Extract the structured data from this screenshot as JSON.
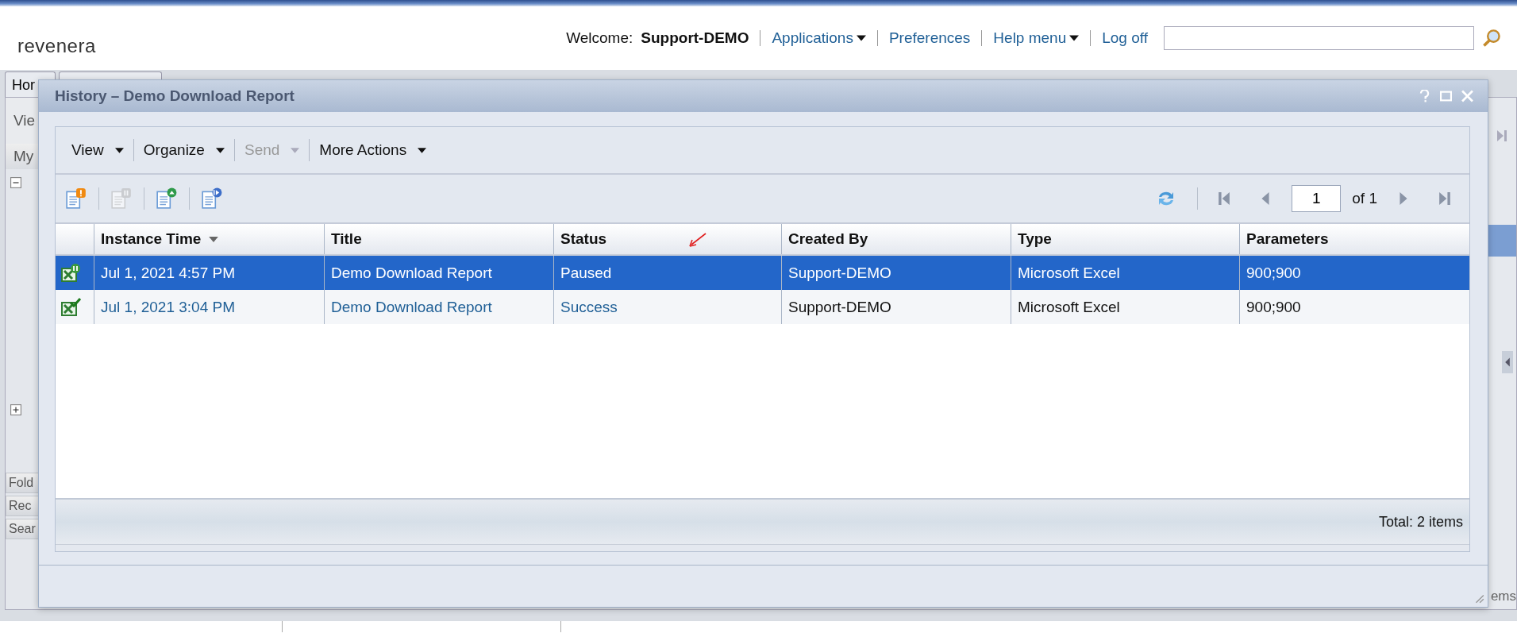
{
  "header": {
    "logo": "revenera",
    "welcome_label": "Welcome:",
    "user": "Support-DEMO",
    "menu": [
      {
        "label": "Applications",
        "dropdown": true
      },
      {
        "label": "Preferences",
        "dropdown": false
      },
      {
        "label": "Help menu",
        "dropdown": true
      },
      {
        "label": "Log off",
        "dropdown": false
      }
    ]
  },
  "background": {
    "tab": "Hor",
    "toolbar_label": "Vie",
    "panel_header": "My",
    "sections": [
      "Fold",
      "Rec",
      "Sear"
    ],
    "status_fragment": "ems"
  },
  "dialog": {
    "title": "History – Demo Download Report",
    "menus": [
      {
        "label": "View",
        "disabled": false
      },
      {
        "label": "Organize",
        "disabled": false
      },
      {
        "label": "Send",
        "disabled": true
      },
      {
        "label": "More Actions",
        "disabled": false
      }
    ],
    "tools": [
      {
        "kind": "alert",
        "disabled": false
      },
      {
        "kind": "pause",
        "disabled": true
      },
      {
        "kind": "upload",
        "disabled": false
      },
      {
        "kind": "resume",
        "disabled": false
      }
    ],
    "pager": {
      "page": "1",
      "of": "of 1"
    },
    "columns": [
      {
        "label": "Instance Time",
        "sorted": true
      },
      {
        "label": "Title",
        "sorted": false
      },
      {
        "label": "Status",
        "sorted": false
      },
      {
        "label": "Created By",
        "sorted": false
      },
      {
        "label": "Type",
        "sorted": false
      },
      {
        "label": "Parameters",
        "sorted": false
      }
    ],
    "rows": [
      {
        "kind": "paused",
        "selected": true,
        "cells": [
          {
            "text": "Jul 1, 2021 4:57 PM"
          },
          {
            "text": "Demo Download Report"
          },
          {
            "text": "Paused"
          },
          {
            "text": "Support-DEMO"
          },
          {
            "text": "Microsoft Excel"
          },
          {
            "text": "900;900"
          }
        ]
      },
      {
        "kind": "success",
        "selected": false,
        "cells": [
          {
            "text": "Jul 1, 2021 3:04 PM",
            "link": true
          },
          {
            "text": "Demo Download Report",
            "link": true
          },
          {
            "text": "Success",
            "link": true
          },
          {
            "text": "Support-DEMO",
            "link": false
          },
          {
            "text": "Microsoft Excel",
            "link": false
          },
          {
            "text": "900;900",
            "link": false
          }
        ]
      }
    ],
    "total": "Total: 2 items"
  }
}
